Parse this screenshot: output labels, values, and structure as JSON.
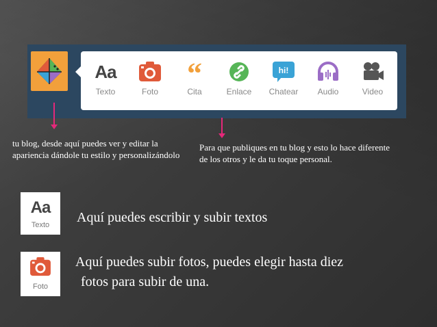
{
  "brand": {
    "icon": "tumblr-logo-icon",
    "color": "#f2a03b"
  },
  "toolbar": {
    "strip_color": "#2c4760",
    "post_types": [
      {
        "label": "Texto",
        "icon": "text-aa-icon",
        "color": "#444444"
      },
      {
        "label": "Foto",
        "icon": "camera-icon",
        "color": "#e05a3a"
      },
      {
        "label": "Cita",
        "icon": "quote-icon",
        "color": "#f2a03b"
      },
      {
        "label": "Enlace",
        "icon": "link-icon",
        "color": "#56b557"
      },
      {
        "label": "Chatear",
        "icon": "chat-bubble-icon",
        "color": "#3aa3d6"
      },
      {
        "label": "Audio",
        "icon": "headphones-icon",
        "color": "#9b6dc6"
      },
      {
        "label": "Video",
        "icon": "video-camera-icon",
        "color": "#555555"
      }
    ],
    "chat_badge_text": "hi!"
  },
  "arrow_color": "#e6287a",
  "notes": {
    "left": "tu blog, desde aquí puedes ver y editar la apariencia dándole tu estilo y personalizándolo",
    "right": "Para que publiques en tu blog  y  esto lo hace diferente de los otros y le da tu toque personal."
  },
  "cards": {
    "text": {
      "label": "Texto",
      "glyph": "Aa",
      "caption": "Aquí puedes escribir y subir textos"
    },
    "photo": {
      "label": "Foto",
      "caption_line1": "Aquí puedes subir fotos, puedes elegir hasta diez",
      "caption_line2": "fotos para subir de una."
    }
  }
}
